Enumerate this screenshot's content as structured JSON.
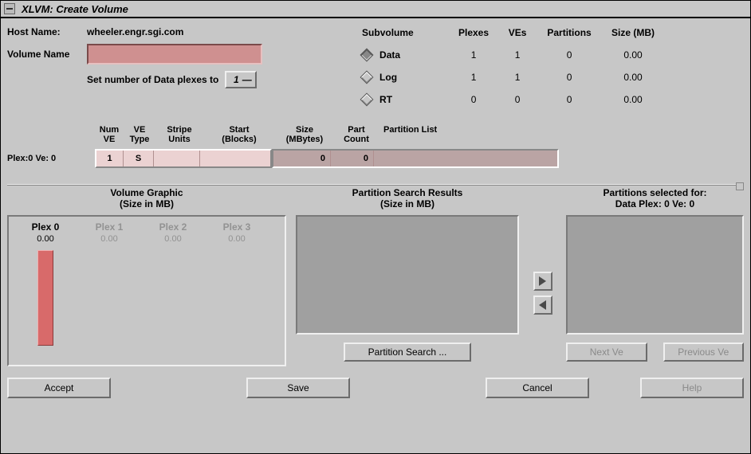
{
  "window": {
    "title": "XLVM: Create Volume"
  },
  "host": {
    "label": "Host Name:",
    "value": "wheeler.engr.sgi.com"
  },
  "volume": {
    "label": "Volume Name",
    "value": ""
  },
  "plex_count": {
    "label": "Set number of Data plexes to",
    "value": "1",
    "glyph": "—"
  },
  "subvolume_table": {
    "headers": {
      "sub": "Subvolume",
      "plexes": "Plexes",
      "ves": "VEs",
      "parts": "Partitions",
      "size": "Size (MB)"
    },
    "rows": [
      {
        "selected": true,
        "name": "Data",
        "plexes": "1",
        "ves": "1",
        "parts": "0",
        "size": "0.00"
      },
      {
        "selected": false,
        "name": "Log",
        "plexes": "1",
        "ves": "1",
        "parts": "0",
        "size": "0.00"
      },
      {
        "selected": false,
        "name": "RT",
        "plexes": "0",
        "ves": "0",
        "parts": "0",
        "size": "0.00"
      }
    ]
  },
  "grid": {
    "headers": {
      "numve": "Num\nVE",
      "vetype": "VE\nType",
      "stripe": "Stripe\nUnits",
      "start": "Start\n(Blocks)",
      "size": "Size\n(MBytes)",
      "partc": "Part\nCount",
      "partlist": "Partition List"
    },
    "row": {
      "label": "Plex:0 Ve: 0",
      "numve": "1",
      "vetype": "S",
      "stripe": "",
      "start": "",
      "size": "0",
      "partc": "0",
      "partlist": ""
    }
  },
  "volume_graphic": {
    "title": "Volume Graphic",
    "subtitle": "(Size in MB)",
    "plexes": [
      {
        "name": "Plex 0",
        "value": "0.00",
        "active": true
      },
      {
        "name": "Plex 1",
        "value": "0.00",
        "active": false
      },
      {
        "name": "Plex 2",
        "value": "0.00",
        "active": false
      },
      {
        "name": "Plex 3",
        "value": "0.00",
        "active": false
      }
    ]
  },
  "search": {
    "title": "Partition Search Results",
    "subtitle": "(Size in MB)",
    "button": "Partition Search ..."
  },
  "selected": {
    "title": "Partitions selected for:",
    "subtitle": "Data Plex: 0 Ve: 0",
    "next": "Next Ve",
    "prev": "Previous Ve"
  },
  "buttons": {
    "accept": "Accept",
    "save": "Save",
    "cancel": "Cancel",
    "help": "Help"
  }
}
